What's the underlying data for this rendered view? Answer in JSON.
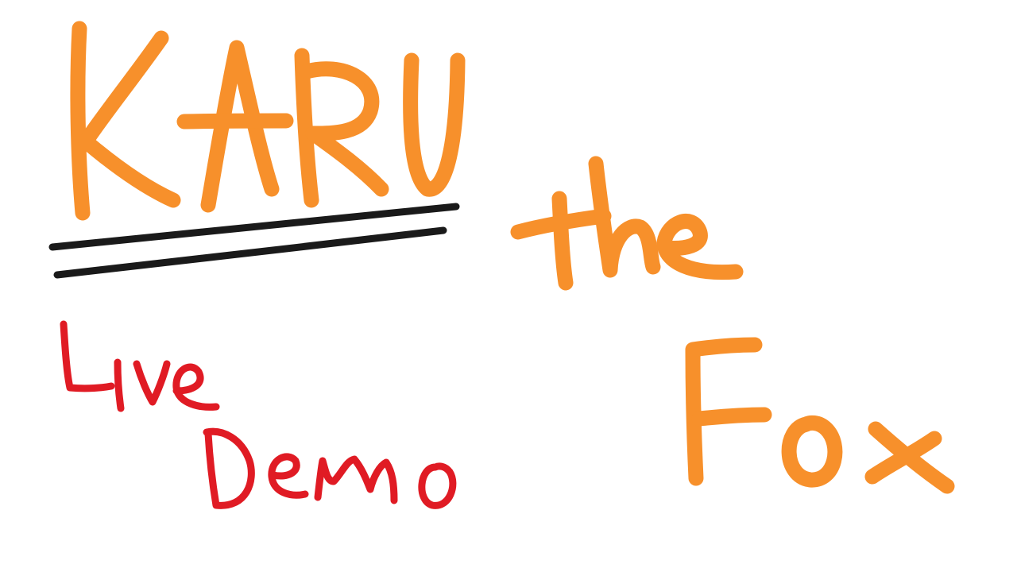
{
  "drawing": {
    "title_word": "KARU",
    "connector_word": "the",
    "subject_word": "Fox",
    "caption_line_1": "Live",
    "caption_line_2": "Demo"
  },
  "colors": {
    "background": "#ffffff",
    "title_orange": "#f7902b",
    "caption_red": "#e01b24",
    "underline_black": "#1a1a1a"
  }
}
